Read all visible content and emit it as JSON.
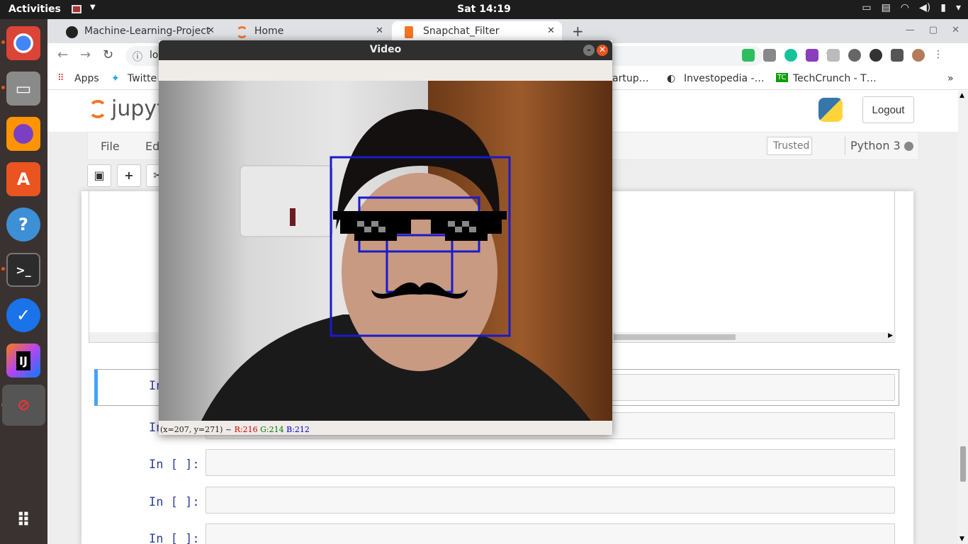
{
  "topbar": {
    "activities": "Activities",
    "clock": "Sat 14:19"
  },
  "dock": {
    "items": [
      "chrome-icon",
      "files-icon",
      "firefox-icon",
      "software-icon",
      "help-icon",
      "terminal-icon",
      "tasks-icon",
      "intellij-icon",
      "video-app-icon",
      "apps-grid-icon"
    ]
  },
  "browser": {
    "tabs": [
      {
        "label": "Machine-Learning-Project"
      },
      {
        "label": "Home"
      },
      {
        "label": "Snapchat_Filter"
      }
    ],
    "url": "loc",
    "bookmarks": {
      "apps": "Apps",
      "twitter": "Twitte",
      "startup": "artup…",
      "investopedia": "Investopedia -…",
      "techcrunch": "TechCrunch - T…",
      "more": "»"
    }
  },
  "jupyter": {
    "logo": "jupyt",
    "logout": "Logout",
    "menu": {
      "file": "File",
      "edit": "Ed"
    },
    "trusted": "Trusted",
    "kernel": "Python 3",
    "cells": [
      {
        "prompt": "In"
      },
      {
        "prompt": "In"
      },
      {
        "prompt": "In [ ]:"
      },
      {
        "prompt": "In [ ]:"
      },
      {
        "prompt": "In [ ]:"
      }
    ]
  },
  "video": {
    "title": "Video",
    "status": {
      "coords": "(x=207, y=271) ~",
      "r": "R:216",
      "g": "G:214",
      "b": "B:212"
    }
  },
  "colors": {
    "accent": "#e95420",
    "prompt": "#303f9f",
    "box": "#1a1acc"
  }
}
